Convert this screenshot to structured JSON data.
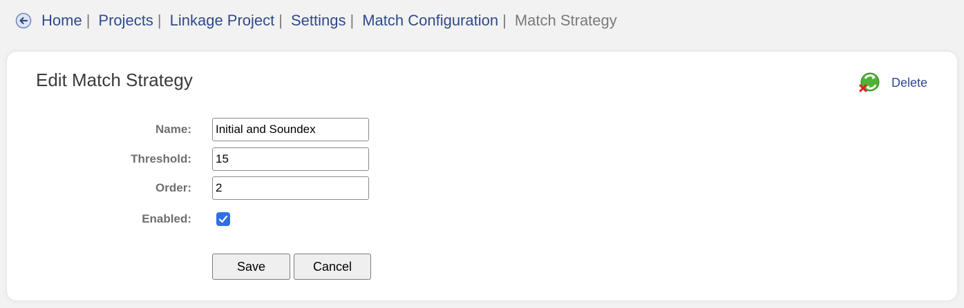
{
  "breadcrumb": {
    "items": [
      {
        "label": "Home",
        "sep": "|"
      },
      {
        "label": "Projects",
        "sep": "|"
      },
      {
        "label": "Linkage Project",
        "sep": "|"
      },
      {
        "label": "Settings",
        "sep": "|"
      },
      {
        "label": "Match Configuration",
        "sep": "|"
      }
    ],
    "current": "Match Strategy",
    "link_color": "#2e4a8c"
  },
  "panel": {
    "title": "Edit Match Strategy",
    "delete_label": "Delete"
  },
  "form": {
    "name_label": "Name:",
    "name_value": "Initial and Soundex",
    "threshold_label": "Threshold:",
    "threshold_value": "15",
    "order_label": "Order:",
    "order_value": "2",
    "enabled_label": "Enabled:",
    "enabled": true
  },
  "buttons": {
    "save_label": "Save",
    "cancel_label": "Cancel"
  }
}
